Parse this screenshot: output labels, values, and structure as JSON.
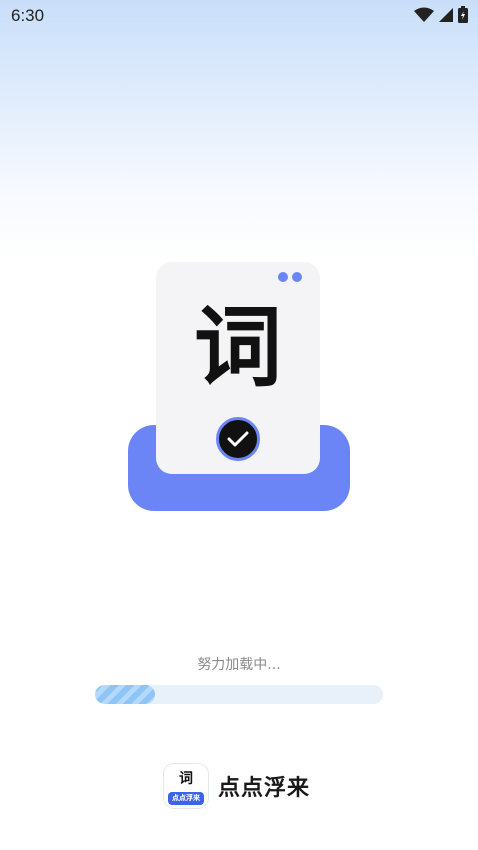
{
  "status_bar": {
    "time": "6:30",
    "icons": [
      "wifi-icon",
      "cellular-signal-icon",
      "battery-icon"
    ]
  },
  "illustration": {
    "glyph": "词",
    "icons": [
      "check-icon"
    ]
  },
  "loading": {
    "text": "努力加载中...",
    "progress_fraction": 0.21
  },
  "brand": {
    "icon_glyph": "词",
    "icon_label": "点点浮来",
    "name": "点点浮来"
  },
  "colors": {
    "accent": "#6b85f6",
    "progress": "#8ec4f6",
    "track": "#e8f0fa",
    "brand_blue": "#3f63e8"
  }
}
